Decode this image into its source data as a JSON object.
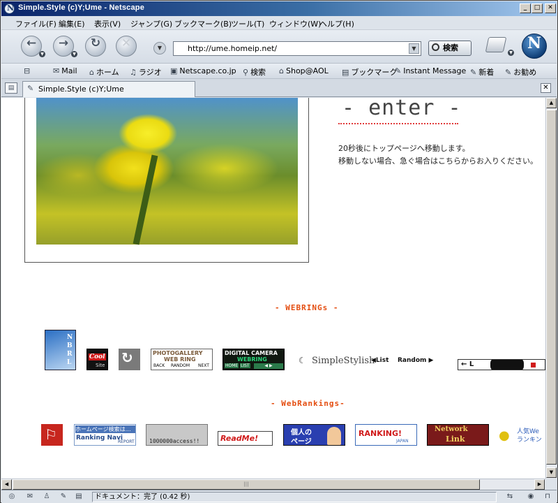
{
  "window": {
    "title": "Simple.Style (c)Y;Ume - Netscape",
    "minimize": "_",
    "maximize": "□",
    "close": "✕"
  },
  "menu": [
    "ファイル(F)",
    "編集(E)",
    "表示(V)",
    "ジャンプ(G)",
    "ブックマーク(B)",
    "ツール(T)",
    "ウィンドウ(W)",
    "ヘルプ(H)"
  ],
  "toolbar": {
    "back_icon": "←",
    "forward_icon": "→",
    "reload_icon": "↻",
    "stop_icon": "✕",
    "url": "http://ume.homeip.net/",
    "search_label": "検索",
    "logo_letter": "N"
  },
  "bookmarks": [
    {
      "label": "Mail",
      "icon": "✉"
    },
    {
      "label": "ホーム",
      "icon": "⌂"
    },
    {
      "label": "ラジオ",
      "icon": "♫"
    },
    {
      "label": "Netscape.co.jp",
      "icon": "▣"
    },
    {
      "label": "検索",
      "icon": "⚲"
    },
    {
      "label": "Shop@AOL",
      "icon": "⌂"
    },
    {
      "label": "ブックマーク",
      "icon": "▤"
    },
    {
      "label": "Instant Message",
      "icon": "✎"
    },
    {
      "label": "新着",
      "icon": "✎"
    },
    {
      "label": "お勧め",
      "icon": "✎"
    }
  ],
  "tab": {
    "title": "Simple.Style (c)Y;Ume"
  },
  "page": {
    "enter_heading": "- enter -",
    "message_line1": "20秒後にトップページへ移動します。",
    "message_line2": "移動しない場合、急ぐ場合はこちらからお入りください。",
    "webrings_heading": "- WEBRINGs -",
    "rankings_heading": "- WebRankings-",
    "webrings": {
      "nbrl": "NBRL",
      "cool": "Cool",
      "cool_sub": "Site",
      "photogallery_line1": "PHOTOGALLERY",
      "photogallery_line2": "WEB RING",
      "photogallery_back": "BACK",
      "photogallery_random": "RANDOM",
      "photogallery_next": "NEXT",
      "digicam_line1": "DIGITAL CAMERA",
      "digicam_line2": "WEBRING",
      "digicam_home": "HOME",
      "digicam_list": "LIST",
      "simplestylish": "SimpleStylish",
      "simplestylish_list": "◀List",
      "simplestylish_random": "Random ▶",
      "partial_ring": "← L"
    },
    "rankings": {
      "ranking_navi_line1": "ホームページ検索は…",
      "ranking_navi_line2": "Ranking Navi",
      "ranking_navi_report": "REPORT",
      "access": "1000000access!!",
      "readme": "ReadMe!",
      "kojin_line1": "個人の",
      "kojin_line2": "ページ",
      "ranking_japan": "RANKING!",
      "ranking_japan_sub": "JAPAN",
      "network_line1": "Network",
      "network_line2": "Link",
      "ninki_line1": "人気We",
      "ninki_line2": "ランキン"
    }
  },
  "status": {
    "text": "ドキュメント：完了 (0.42 秒)"
  }
}
